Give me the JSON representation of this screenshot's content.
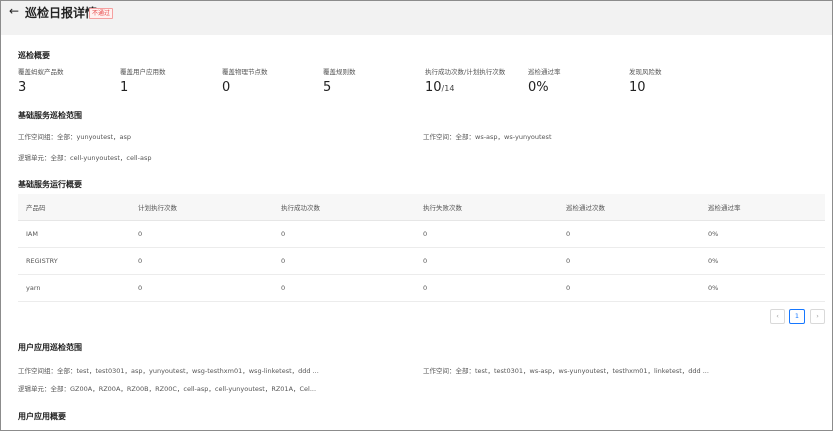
{
  "header": {
    "back_glyph": "←",
    "title": "巡检日报详情",
    "status_tag": "不通过"
  },
  "overview": {
    "title": "巡检概要",
    "metrics": [
      {
        "label": "覆盖蚂蚁产品数",
        "value": "3"
      },
      {
        "label": "覆盖用户应用数",
        "value": "1"
      },
      {
        "label": "覆盖物理节点数",
        "value": "0"
      },
      {
        "label": "覆盖规则数",
        "value": "5"
      },
      {
        "label": "执行成功次数/计划执行次数",
        "value": "10",
        "denominator": "/14"
      },
      {
        "label": "巡检通过率",
        "value": "0%"
      },
      {
        "label": "发现风险数",
        "value": "10"
      }
    ]
  },
  "basic_scope": {
    "title": "基础服务巡检范围",
    "workspace_group": "工作空间组：全部：yunyoutest，asp",
    "workspace": "工作空间：全部：ws-asp，ws-yunyoutest",
    "logic_unit": "逻辑单元：全部：cell-yunyoutest，cell-asp"
  },
  "basic_run": {
    "title": "基础服务运行概要",
    "columns": [
      "产品码",
      "计划执行次数",
      "执行成功次数",
      "执行失败次数",
      "巡检通过次数",
      "巡检通过率"
    ],
    "rows": [
      [
        "IAM",
        "0",
        "0",
        "0",
        "0",
        "0%"
      ],
      [
        "REGISTRY",
        "0",
        "0",
        "0",
        "0",
        "0%"
      ],
      [
        "yarn",
        "0",
        "0",
        "0",
        "0",
        "0%"
      ]
    ]
  },
  "pagination": {
    "prev": "‹",
    "current": "1",
    "next": "›"
  },
  "user_scope": {
    "title": "用户应用巡检范围",
    "workspace_group": "工作空间组：全部：test，test0301，asp，yunyoutest，wsg-testhxm01，wsg-linketest，ddd ...",
    "workspace": "工作空间：全部：test，test0301，ws-asp，ws-yunyoutest，testhxm01，linketest，ddd ...",
    "logic_unit": "逻辑单元：全部：GZ00A，RZ00A，RZ00B，RZ00C，cell-asp，cell-yunyoutest，RZ01A，Cel..."
  },
  "user_overview": {
    "title": "用户应用概要"
  }
}
